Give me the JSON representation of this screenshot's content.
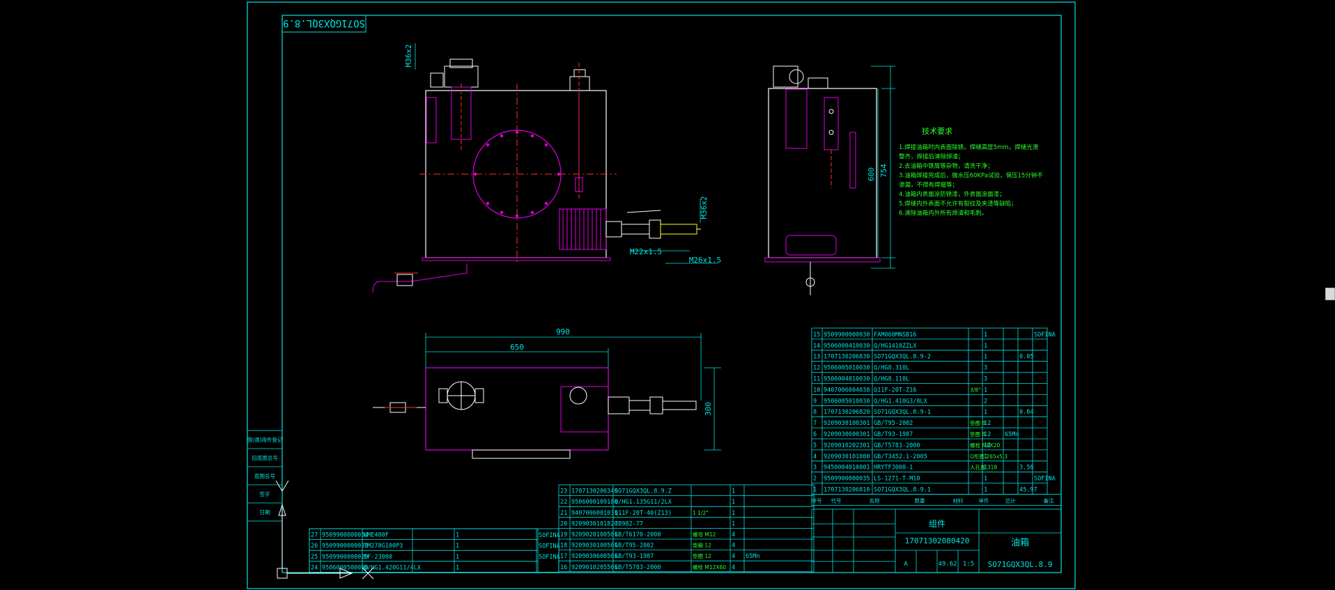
{
  "drawing": {
    "stamp": "SO71GQX3QL.8.9",
    "drawing_no": "SO71GQX3QL.8.9",
    "part_code": "17071302080420",
    "part_name": "油箱",
    "title_label": "组件",
    "mass": "49.62",
    "scale": "1:5",
    "stage": "A"
  },
  "dimensions": {
    "d_990": "990",
    "d_650": "650",
    "d_300": "300",
    "d_600": "600",
    "d_754": "754",
    "m36x2_a": "M36x2",
    "m36x2_b": "M36x2",
    "m22x15": "M22x1.5",
    "m26x15": "M26x1.5"
  },
  "technical_requirements": {
    "title": "技术要求",
    "lines": [
      "1.焊接油箱时内表面除锈，焊缝高度5mm，焊缝光滑",
      "   整齐，焊接后清除焊渣；",
      "2.去油箱中铁屑等杂物，清洗干净；",
      "3.油箱焊接完成后，做水压60KPa试验，保压15分钟不",
      "   渗漏，不得有焊瘤等；",
      "4.油箱内表面涂防锈漆，外表面涂面漆；",
      "5.焊缝内外表面不允许有裂纹及夹渣等缺陷；",
      "6.清除油箱内外所有焊渣和毛刺。"
    ]
  },
  "bom_right": [
    {
      "no": "15",
      "code": "9509900000030",
      "std": "FAM060MNSB16",
      "name": "",
      "qty": "1",
      "mat": "",
      "w1": "",
      "w2": "",
      "note": "SOFINA"
    },
    {
      "no": "14",
      "code": "9506000410030",
      "std": "Q/HG1410ZZLX",
      "name": "",
      "qty": "1",
      "mat": "",
      "w1": "",
      "w2": "",
      "note": ""
    },
    {
      "no": "13",
      "code": "1707130206830",
      "std": "SO71GQX3QL.8.9-2",
      "name": "",
      "qty": "1",
      "mat": "",
      "w1": "0.05",
      "w2": "0.05",
      "note": ""
    },
    {
      "no": "12",
      "code": "9506005010030",
      "std": "Q/HG8.310L",
      "name": "",
      "qty": "3",
      "mat": "",
      "w1": "",
      "w2": "",
      "note": ""
    },
    {
      "no": "11",
      "code": "9506004810030",
      "std": "Q/HG8.110L",
      "name": "",
      "qty": "3",
      "mat": "",
      "w1": "",
      "w2": "",
      "note": ""
    },
    {
      "no": "10",
      "code": "9407006004038",
      "std": "Q11F-20T-Z16",
      "name": "3/8\"",
      "qty": "1",
      "mat": "",
      "w1": "",
      "w2": "",
      "note": ""
    },
    {
      "no": "9",
      "code": "9506005010030",
      "std": "Q/HG1.410G3/8LX",
      "name": "",
      "qty": "2",
      "mat": "",
      "w1": "",
      "w2": "",
      "note": ""
    },
    {
      "no": "8",
      "code": "1707130206820",
      "std": "SO71GQX3QL.8.9-1",
      "name": "",
      "qty": "1",
      "mat": "",
      "w1": "0.04",
      "w2": "0.04",
      "note": ""
    },
    {
      "no": "7",
      "code": "9209030100301",
      "std": "GB/T95-2002",
      "name": "垫圈 8",
      "qty": "12",
      "mat": "",
      "w1": "",
      "w2": "",
      "note": ""
    },
    {
      "no": "6",
      "code": "9209030600301",
      "std": "GB/T93-1987",
      "name": "垫圈 8",
      "qty": "12",
      "mat": "65Mn",
      "w1": "",
      "w2": "",
      "note": ""
    },
    {
      "no": "5",
      "code": "9209010202301",
      "std": "GB/T5783-2000",
      "name": "螺栓 M8X20",
      "qty": "12",
      "mat": "",
      "w1": "",
      "w2": "",
      "note": ""
    },
    {
      "no": "4",
      "code": "9209030101080",
      "std": "GB/T3452.1-2005",
      "name": "O形圈 265x5.3",
      "qty": "1",
      "mat": "",
      "w1": "",
      "w2": "",
      "note": ""
    },
    {
      "no": "3",
      "code": "9450004010001",
      "std": "HRYTFJ000-1",
      "name": "人孔盖 318",
      "qty": "1",
      "mat": "",
      "w1": "3.56",
      "w2": "3.56",
      "note": ""
    },
    {
      "no": "2",
      "code": "9509900000035",
      "std": "LS-1271-T-M10",
      "name": "",
      "qty": "1",
      "mat": "",
      "w1": "",
      "w2": "",
      "note": "SOFINA"
    },
    {
      "no": "1",
      "code": "1707130206810",
      "std": "SO71GQX3QL.8.9.1",
      "name": "",
      "qty": "1",
      "mat": "",
      "w1": "45.97",
      "w2": "45.97",
      "note": ""
    }
  ],
  "bom_mid": [
    {
      "no": "23",
      "code": "1707130206340",
      "std": "SO71GQX3QL.8.9.Z",
      "name": "",
      "qty": "1",
      "note": ""
    },
    {
      "no": "22",
      "code": "9506000109180",
      "std": "Q/HG1.135G11/2LX",
      "name": "",
      "qty": "1",
      "note": ""
    },
    {
      "no": "21",
      "code": "9407006001031",
      "std": "Q11F-20T-40(Z13)",
      "name": "1 1/2\"",
      "qty": "1",
      "note": ""
    },
    {
      "no": "20",
      "code": "9209030101820",
      "std": "JB982-77",
      "name": "",
      "qty": "1",
      "note": ""
    },
    {
      "no": "19",
      "code": "9209020100501",
      "std": "GB/T6170-2000",
      "name": "螺母 M12",
      "qty": "4",
      "note": ""
    },
    {
      "no": "18",
      "code": "9209030100501",
      "std": "GB/T95-2002",
      "name": "垫圈 12",
      "qty": "4",
      "note": ""
    },
    {
      "no": "17",
      "code": "9209030600501",
      "std": "GB/T93-1987",
      "name": "垫圈 12",
      "qty": "4",
      "note": "65Mn"
    },
    {
      "no": "16",
      "code": "9209010205501",
      "std": "GB/T5783-2000",
      "name": "螺栓 M12X60",
      "qty": "4",
      "note": ""
    }
  ],
  "bom_left": [
    {
      "no": "27",
      "code": "9509900000034",
      "std": "LME400F",
      "name": "",
      "qty": "1",
      "note": "SOFINA"
    },
    {
      "no": "26",
      "code": "9509900000033",
      "std": "TM278G100P3",
      "name": "",
      "qty": "1",
      "note": "SOFINA"
    },
    {
      "no": "25",
      "code": "9509900000029",
      "std": "EF-23080",
      "name": "",
      "qty": "1",
      "note": "SOFINA"
    },
    {
      "no": "24",
      "code": "9506000500090",
      "std": "Q/HG1.420G11/4LX",
      "name": "",
      "qty": "1",
      "note": ""
    }
  ],
  "bom_header": [
    "序号",
    "代号",
    "名称",
    "数量",
    "材料",
    "单件",
    "总计",
    "备注"
  ],
  "left_strip": [
    "借(通)用件登记",
    "旧底图总号",
    "底图总号",
    "签字",
    "日期"
  ],
  "colors": {
    "frame": "#00e5e5",
    "magenta": "#e000e0",
    "white": "#ffffff",
    "green": "#29ff29",
    "yellow": "#ffff00",
    "red": "#ff3030"
  }
}
